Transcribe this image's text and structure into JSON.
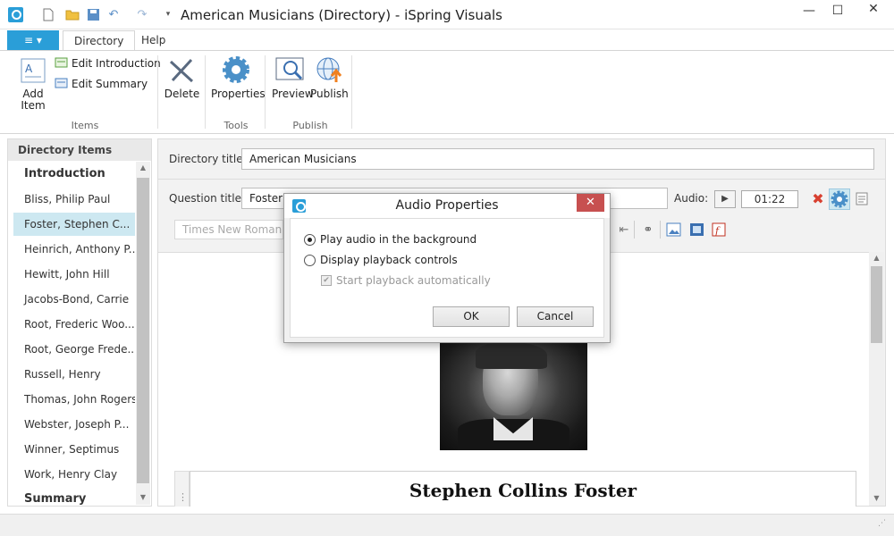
{
  "window": {
    "title": "American Musicians (Directory) - iSpring Visuals",
    "app_icon": "ispring-logo-icon",
    "quick_access": [
      "new-file-icon",
      "open-folder-icon",
      "save-icon",
      "undo-icon",
      "redo-icon",
      "customize-icon"
    ],
    "controls": {
      "minimize": "—",
      "maximize": "☐",
      "close": "✕"
    }
  },
  "ribbon": {
    "file_button": "≡ ▾",
    "tabs": [
      {
        "label": "Directory",
        "active": true
      },
      {
        "label": "Help",
        "active": false
      }
    ],
    "items_group": {
      "label": "Items",
      "add_item": "Add Item",
      "add_item_line1": "Add",
      "add_item_line2": "Item",
      "edit_introduction": "Edit Introduction",
      "edit_summary": "Edit Summary"
    },
    "tools_group": {
      "label": "Tools",
      "delete": "Delete",
      "properties": "Properties"
    },
    "publish_group": {
      "label": "Publish",
      "preview": "Preview",
      "publish": "Publish"
    }
  },
  "sidebar": {
    "header": "Directory Items",
    "items": [
      {
        "label": "Introduction",
        "bold": true
      },
      {
        "label": "Bliss, Philip Paul"
      },
      {
        "label": "Foster, Stephen C...",
        "selected": true
      },
      {
        "label": "Heinrich, Anthony P..."
      },
      {
        "label": "Hewitt, John Hill"
      },
      {
        "label": "Jacobs-Bond, Carrie"
      },
      {
        "label": "Root, Frederic Woo..."
      },
      {
        "label": "Root, George Frede..."
      },
      {
        "label": "Russell, Henry"
      },
      {
        "label": "Thomas, John Rogers"
      },
      {
        "label": "Webster, Joseph P..."
      },
      {
        "label": "Winner, Septimus"
      },
      {
        "label": "Work, Henry Clay"
      },
      {
        "label": "Summary",
        "bold": true
      }
    ],
    "scroll_up": "▲",
    "scroll_down": "▼"
  },
  "editor": {
    "directory_title_label": "Directory title:",
    "directory_title_value": "American Musicians",
    "question_title_label": "Question title:",
    "question_title_value": "Foster,",
    "audio_label": "Audio:",
    "audio_play": "▶",
    "audio_duration": "01:22",
    "font_placeholder": "Times New Roman",
    "content_heading": "Stephen Collins Foster",
    "grip": "⋮"
  },
  "dialog": {
    "title": "Audio Properties",
    "close": "✕",
    "options": [
      {
        "label": "Play audio in the background",
        "selected": true
      },
      {
        "label": "Display playback controls",
        "selected": false
      }
    ],
    "sub_option": {
      "label": "Start playback automatically",
      "checked": true,
      "disabled": true
    },
    "ok": "OK",
    "cancel": "Cancel"
  },
  "colors": {
    "accent": "#2a9ed8",
    "close_red": "#c75050",
    "selection": "#cde8f1"
  }
}
